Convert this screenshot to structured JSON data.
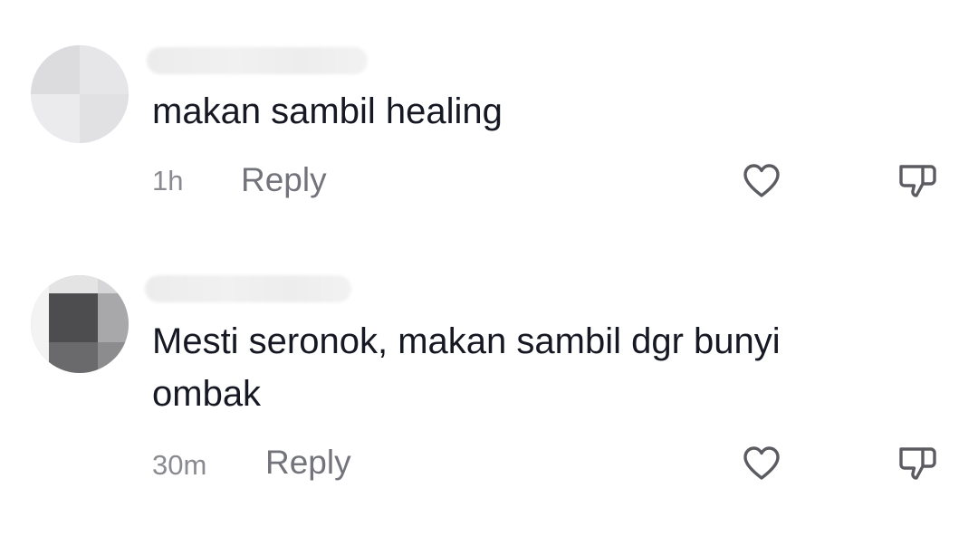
{
  "comments": [
    {
      "text": "makan sambil healing",
      "time": "1h",
      "reply_label": "Reply"
    },
    {
      "text": "Mesti seronok, makan sambil dgr bunyi\nombak",
      "time": "30m",
      "reply_label": "Reply"
    }
  ],
  "icons": {
    "like": "heart-outline-icon",
    "dislike": "thumbs-down-outline-icon"
  },
  "colors": {
    "text": "#161823",
    "meta": "#8a8b91",
    "icon": "#5b5c62"
  }
}
